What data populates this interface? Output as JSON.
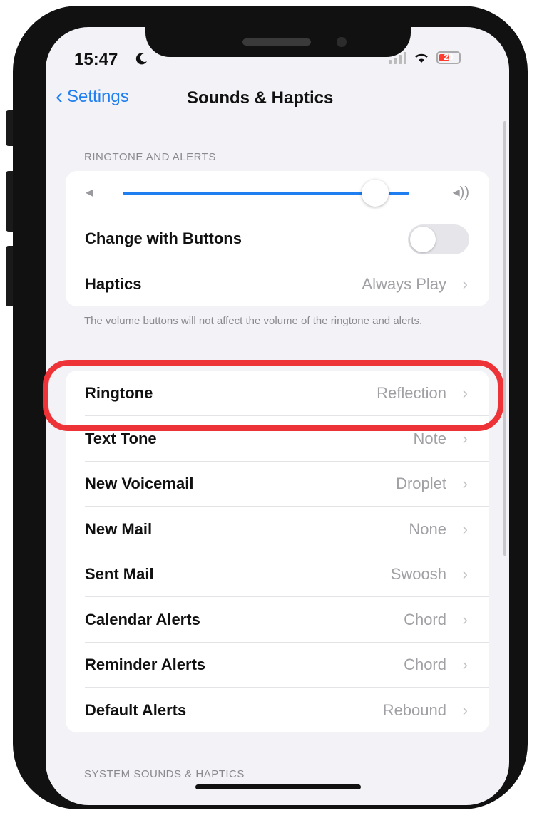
{
  "status": {
    "time": "15:47",
    "battery": "20"
  },
  "nav": {
    "back_label": "Settings",
    "title": "Sounds & Haptics"
  },
  "sections": {
    "ringtone_header": "RINGTONE AND ALERTS",
    "system_header": "SYSTEM SOUNDS & HAPTICS"
  },
  "volume": {
    "level": 0.88
  },
  "settings": {
    "change_with_buttons": {
      "label": "Change with Buttons",
      "on": false
    },
    "haptics": {
      "label": "Haptics",
      "value": "Always Play"
    },
    "footer": "The volume buttons will not affect the volume of the ringtone and alerts."
  },
  "sound_rows": [
    {
      "label": "Ringtone",
      "value": "Reflection"
    },
    {
      "label": "Text Tone",
      "value": "Note"
    },
    {
      "label": "New Voicemail",
      "value": "Droplet"
    },
    {
      "label": "New Mail",
      "value": "None"
    },
    {
      "label": "Sent Mail",
      "value": "Swoosh"
    },
    {
      "label": "Calendar Alerts",
      "value": "Chord"
    },
    {
      "label": "Reminder Alerts",
      "value": "Chord"
    },
    {
      "label": "Default Alerts",
      "value": "Rebound"
    }
  ],
  "colors": {
    "accent": "#1f7ef0",
    "highlight": "#ee3338"
  }
}
